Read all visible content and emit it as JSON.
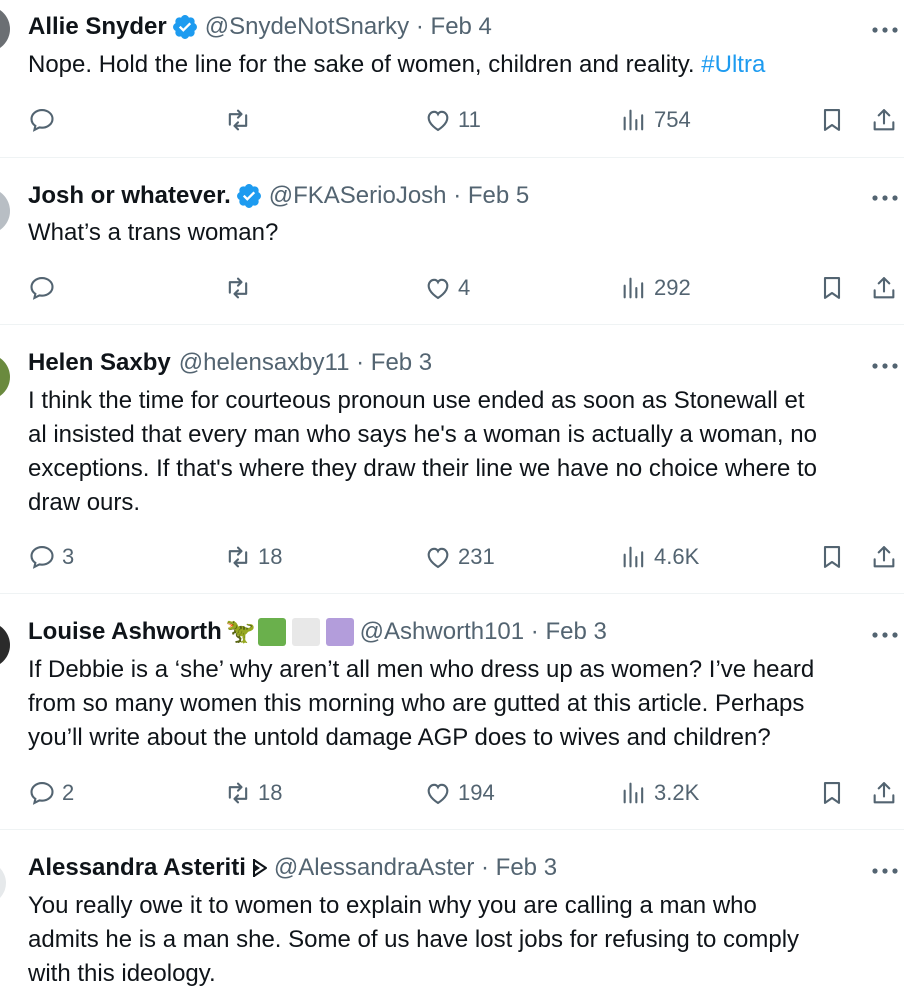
{
  "tweets": [
    {
      "name": "Allie Snyder",
      "verified": true,
      "handle": "@SnydeNotSnarky",
      "separator": "·",
      "date": "Feb 4",
      "text": "Nope. Hold the line for the sake of women, children and reality. ",
      "hashtag": "#Ultra",
      "replies": "",
      "retweets": "",
      "likes": "11",
      "views": "754"
    },
    {
      "name": "Josh or whatever.",
      "verified": true,
      "handle": "@FKASerioJosh",
      "separator": "·",
      "date": "Feb 5",
      "text": "What’s a trans woman?",
      "replies": "",
      "retweets": "",
      "likes": "4",
      "views": "292"
    },
    {
      "name": "Helen Saxby",
      "verified": false,
      "handle": "@helensaxby11",
      "separator": "·",
      "date": "Feb 3",
      "text": "I think the time for courteous pronoun use ended as soon as Stonewall et\nal insisted that every man who says he's a woman is actually a woman, no\nexceptions. If that's where they draw their line we have no choice where to\ndraw ours.",
      "replies": "3",
      "retweets": "18",
      "likes": "231",
      "views": "4.6K"
    },
    {
      "name": "Louise Ashworth",
      "verified": false,
      "name_emoji": "🦖",
      "color_squares": [
        "#6ab04c",
        "#e8e8e8",
        "#b39ddb"
      ],
      "handle": "@Ashworth101",
      "separator": "·",
      "date": "Feb 3",
      "text": "If Debbie is a ‘she’ why aren’t all men who dress up as women? I’ve heard\nfrom so many women this morning who are gutted at this article. Perhaps\nyou’ll write about the untold damage AGP does to wives and children?",
      "replies": "2",
      "retweets": "18",
      "likes": "194",
      "views": "3.2K"
    },
    {
      "name": "Alessandra Asteriti",
      "verified": false,
      "name_icon": "flag-mark-icon",
      "handle": "@AlessandraAster",
      "separator": "·",
      "date": "Feb 3",
      "text": "You really owe it to women to explain why you are calling a man who\nadmits he is a man she. Some of us have lost jobs for refusing to comply\nwith this ideology."
    }
  ],
  "colors": {
    "text": "#0f1419",
    "secondary": "#536471",
    "accent": "#1d9bf0",
    "divider": "#eff3f4"
  },
  "icons": {
    "reply": "speech-bubble-icon",
    "retweet": "retweet-arrows-icon",
    "like": "heart-icon",
    "views": "bar-chart-icon",
    "bookmark": "bookmark-icon",
    "share": "share-upload-icon",
    "more": "ellipsis-icon",
    "verified": "verified-badge-icon"
  }
}
